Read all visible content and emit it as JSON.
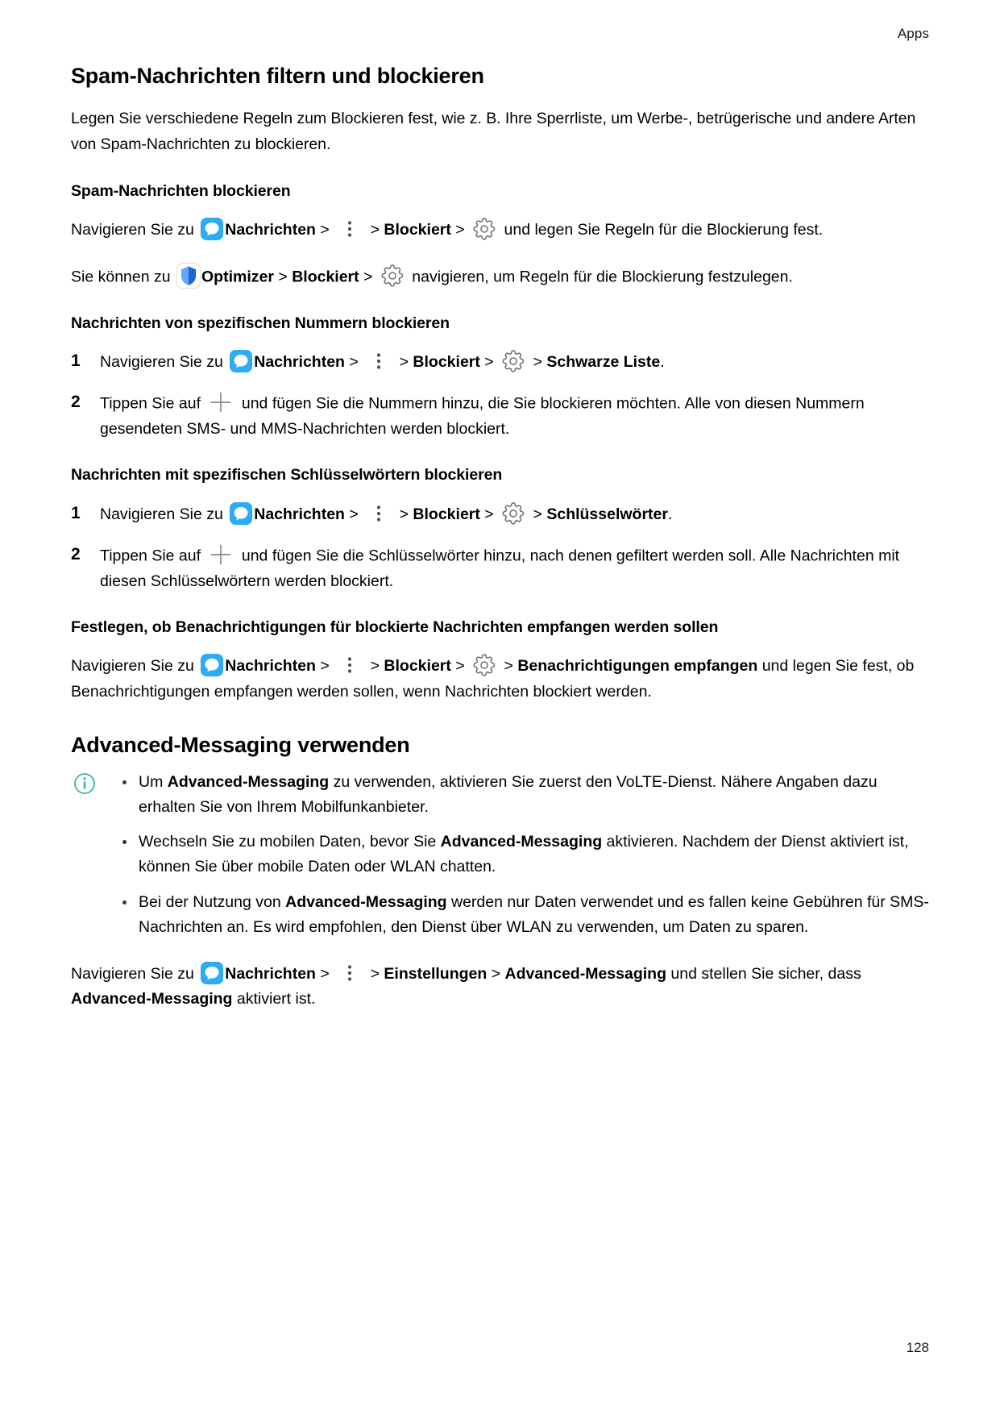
{
  "header": {
    "section": "Apps"
  },
  "footer": {
    "page_number": "128"
  },
  "colors": {
    "messages_icon_blue": "#2eabf5",
    "shield_icon_blue": "#2b7ef0",
    "gear_icon_gray": "#6e6e6e",
    "plus_icon_gray": "#8a8a8a",
    "info_icon_teal": "#36b5b0",
    "text": "#000000"
  },
  "title": "Spam-Nachrichten filtern und blockieren",
  "intro": "Legen Sie verschiedene Regeln zum Blockieren fest, wie z. B. Ihre Sperrliste, um Werbe-, betrügerische und andere Arten von Spam-Nachrichten zu blockieren.",
  "section_block_spam": {
    "heading": "Spam-Nachrichten blockieren",
    "line1": {
      "t1": "Navigieren Sie zu ",
      "app": "Nachrichten",
      "s1": " > ",
      "s2": " > ",
      "blocked": "Blockiert",
      "s3": " > ",
      "t2": " und legen Sie Regeln für die Blockierung fest."
    },
    "line2": {
      "t1": "Sie können zu ",
      "app": "Optimizer",
      "s1": " > ",
      "blocked": "Blockiert",
      "s2": " > ",
      "t2": " navigieren, um Regeln für die Blockierung festzulegen."
    }
  },
  "section_block_numbers": {
    "heading": "Nachrichten von spezifischen Nummern blockieren",
    "step1": {
      "num": "1",
      "t1": "Navigieren Sie zu ",
      "app": "Nachrichten",
      "s1": " > ",
      "s2": " > ",
      "blocked": "Blockiert",
      "s3": " > ",
      "target": "Schwarze Liste",
      "t2": "."
    },
    "step2": {
      "num": "2",
      "t1": "Tippen Sie auf ",
      "t2": " und fügen Sie die Nummern hinzu, die Sie blockieren möchten. Alle von diesen Nummern gesendeten SMS- und MMS-Nachrichten werden blockiert."
    }
  },
  "section_block_keywords": {
    "heading": "Nachrichten mit spezifischen Schlüsselwörtern blockieren",
    "step1": {
      "num": "1",
      "t1": "Navigieren Sie zu ",
      "app": "Nachrichten",
      "s1": " > ",
      "s2": " > ",
      "blocked": "Blockiert",
      "s3": " > ",
      "target": "Schlüsselwörter",
      "t2": "."
    },
    "step2": {
      "num": "2",
      "t1": "Tippen Sie auf ",
      "t2": " und fügen Sie die Schlüsselwörter hinzu, nach denen gefiltert werden soll. Alle Nachrichten mit diesen Schlüsselwörtern werden blockiert."
    }
  },
  "section_notifications": {
    "heading": "Festlegen, ob Benachrichtigungen für blockierte Nachrichten empfangen werden sollen",
    "line": {
      "t1": "Navigieren Sie zu ",
      "app": "Nachrichten",
      "s1": " > ",
      "s2": " > ",
      "blocked": "Blockiert",
      "s3": " > ",
      "target": "Benachrichtigungen empfangen",
      "t2": " und legen Sie fest, ob Benachrichtigungen empfangen werden sollen, wenn Nachrichten blockiert werden."
    }
  },
  "section_advanced_messaging": {
    "heading": "Advanced-Messaging verwenden",
    "notes": [
      {
        "p1": "Um ",
        "b1": "Advanced-Messaging",
        "p2": " zu verwenden, aktivieren Sie zuerst den VoLTE-Dienst. Nähere Angaben dazu erhalten Sie von Ihrem Mobilfunkanbieter."
      },
      {
        "p1": "Wechseln Sie zu mobilen Daten, bevor Sie ",
        "b1": "Advanced-Messaging",
        "p2": " aktivieren. Nachdem der Dienst aktiviert ist, können Sie über mobile Daten oder WLAN chatten."
      },
      {
        "p1": "Bei der Nutzung von ",
        "b1": "Advanced-Messaging",
        "p2": " werden nur Daten verwendet und es fallen keine Gebühren für SMS-Nachrichten an. Es wird empfohlen, den Dienst über WLAN zu verwenden, um Daten zu sparen."
      }
    ],
    "line": {
      "t1": "Navigieren Sie zu ",
      "app": "Nachrichten",
      "s1": " > ",
      "s2": " > ",
      "settings": "Einstellungen",
      "s3": " > ",
      "target": "Advanced-Messaging",
      "t2": " und stellen Sie sicher, dass ",
      "b2": "Advanced-Messaging",
      "t3": " aktiviert ist."
    }
  },
  "icons": {
    "messages": "messages-app-icon",
    "optimizer": "optimizer-shield-icon",
    "overflow": "three-dot-menu-icon",
    "settings_gear": "gear-icon",
    "add": "plus-icon",
    "info": "info-icon"
  }
}
